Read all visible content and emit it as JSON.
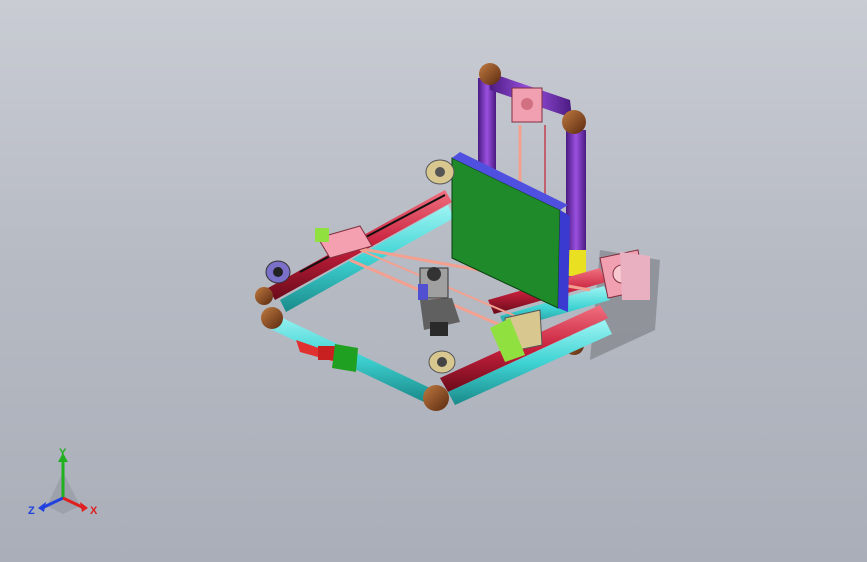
{
  "viewport": {
    "background_top": "#c9ccd3",
    "background_bottom": "#a9aeb8"
  },
  "model": {
    "part_colors": {
      "frame_teal": "#3fd3d3",
      "frame_red": "#c8203c",
      "frame_purple": "#7b2fbf",
      "corner_bronze": "#8a4a22",
      "bed_green": "#1f8a2a",
      "bed_plate_blue": "#3a3ad0",
      "motor_pink": "#f0a0b0",
      "rod_salmon": "#f4a090",
      "bracket_lime": "#90e040",
      "clamp_red": "#e03030",
      "accent_yellow": "#e8e020"
    }
  },
  "triad": {
    "y_label": "Y",
    "z_label": "Z",
    "x_label": "X",
    "y_color": "#20b020",
    "z_color": "#2040e0",
    "x_color": "#e02020"
  }
}
